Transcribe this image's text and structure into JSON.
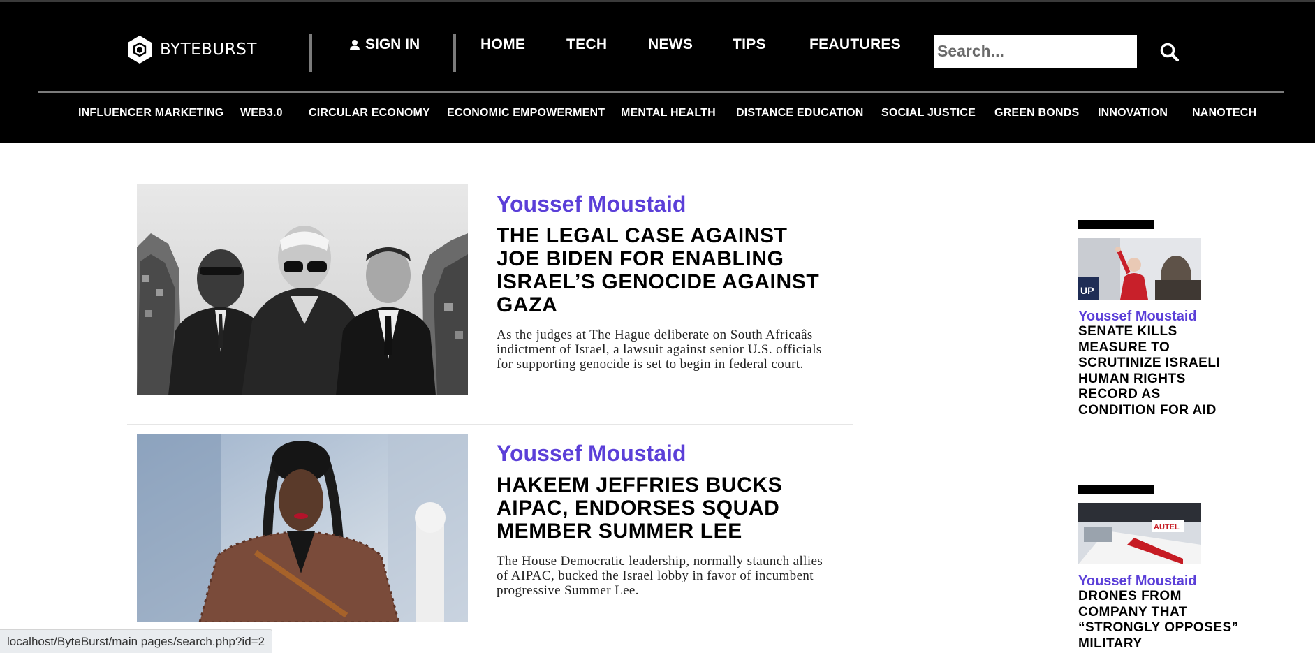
{
  "brand": {
    "name": "BYTEBURST",
    "logo_icon": "hexagon-logo-icon"
  },
  "header": {
    "signin_label": "SIGN IN",
    "signin_icon": "user-icon",
    "nav": [
      "HOME",
      "TECH",
      "NEWS",
      "TIPS",
      "FEAUTURES"
    ],
    "search_placeholder": "Search...",
    "search_icon": "search-icon"
  },
  "subnav": [
    "INFLUENCER MARKETING",
    "WEB3.0",
    "CIRCULAR ECONOMY",
    "ECONOMIC EMPOWERMENT",
    "MENTAL HEALTH",
    "DISTANCE EDUCATION",
    "SOCIAL JUSTICE",
    "GREEN BONDS",
    "INNOVATION",
    "NANOTECH"
  ],
  "articles": [
    {
      "author": "Youssef Moustaid",
      "title": "THE LEGAL CASE AGAINST JOE BIDEN FOR ENABLING ISRAEL’S GENOCIDE AGAINST GAZA",
      "excerpt": "As the judges at The Hague deliberate on South Africaâs indictment of Israel, a lawsuit against senior U.S. officials for supporting genocide is set to begin in federal court."
    },
    {
      "author": "Youssef Moustaid",
      "title": "HAKEEM JEFFRIES BUCKS AIPAC, ENDORSES SQUAD MEMBER SUMMER LEE",
      "excerpt": "The House Democratic leadership, normally staunch allies of AIPAC, bucked the Israel lobby in favor of incumbent progressive Summer Lee."
    }
  ],
  "sidebar": [
    {
      "author": "Youssef Moustaid",
      "title": "SENATE KILLS MEASURE TO SCRUTINIZE ISRAELI HUMAN RIGHTS RECORD AS CONDITION FOR AID"
    },
    {
      "author": "Youssef Moustaid",
      "title": "DRONES FROM COMPANY THAT “STRONGLY OPPOSES” MILITARY"
    }
  ],
  "status_bar": {
    "url": "localhost/ByteBurst/main pages/search.php?id=2"
  },
  "colors": {
    "header_bg": "#000000",
    "author_accent": "#5b3fd8",
    "divider": "#7b7b7b"
  }
}
